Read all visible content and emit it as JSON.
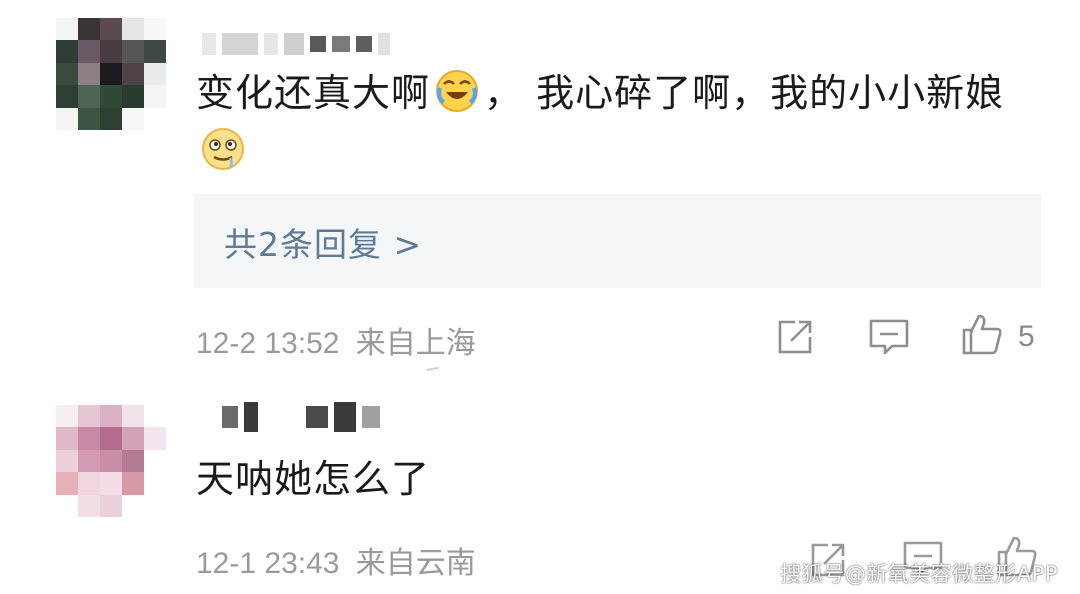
{
  "comments": [
    {
      "text_before": "变化还真大啊",
      "text_mid": "， 我心碎了啊，我的小小新娘",
      "emoji_1": "laugh-cry-emoji",
      "emoji_2": "drooling-face-emoji",
      "replies_label": "共2条回复 >",
      "timestamp": "12-2 13:52",
      "location": "来自上海",
      "like_count": "5"
    },
    {
      "text": "天呐她怎么了",
      "timestamp": "12-1 23:43",
      "location": "来自云南",
      "like_count": ""
    }
  ],
  "watermark": "搜狐号@新氧美容微整形APP",
  "colors": {
    "link": "#5e7b96",
    "meta": "#9a9a9a",
    "reply_bg": "#f5f6f8",
    "icon": "#8e8e8e"
  }
}
